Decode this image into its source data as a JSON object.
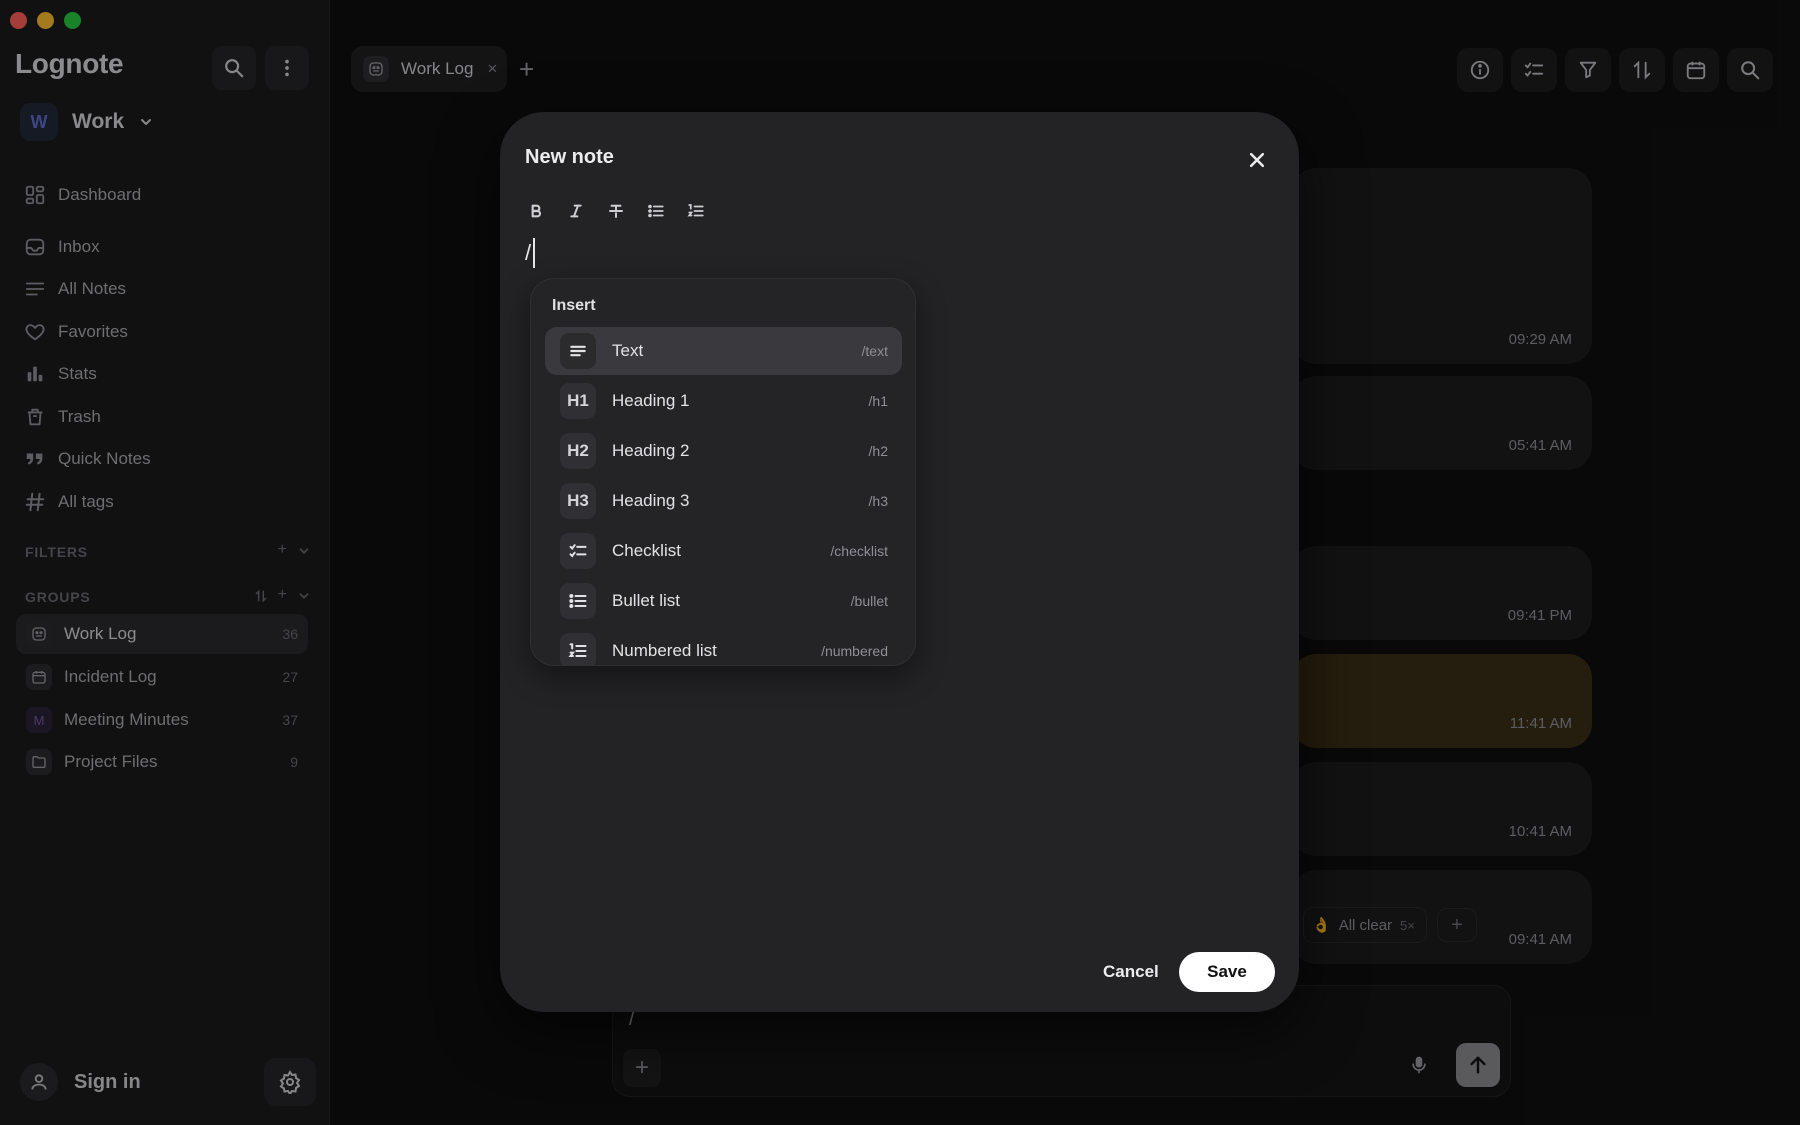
{
  "window": {
    "controls": [
      "close",
      "minimize",
      "zoom"
    ]
  },
  "sidebar": {
    "app_title": "Lognote",
    "workspace": {
      "avatar_letter": "W",
      "name": "Work"
    },
    "nav": [
      {
        "label": "Dashboard",
        "icon": "dashboard-icon"
      },
      {
        "label": "Inbox",
        "icon": "inbox-icon"
      },
      {
        "label": "All Notes",
        "icon": "notes-icon"
      },
      {
        "label": "Favorites",
        "icon": "heart-icon"
      },
      {
        "label": "Stats",
        "icon": "stats-icon"
      },
      {
        "label": "Trash",
        "icon": "trash-icon"
      },
      {
        "label": "Quick Notes",
        "icon": "quote-icon"
      },
      {
        "label": "All tags",
        "icon": "hash-icon"
      }
    ],
    "filters_label": "FILTERS",
    "groups_label": "GROUPS",
    "groups": [
      {
        "label": "Work Log",
        "count": "36",
        "icon": "worklog-icon"
      },
      {
        "label": "Incident Log",
        "count": "27",
        "icon": "calendar-icon"
      },
      {
        "label": "Meeting Minutes",
        "count": "37",
        "icon_letter": "M"
      },
      {
        "label": "Project Files",
        "count": "9",
        "icon": "folder-icon"
      }
    ],
    "signin_label": "Sign in"
  },
  "main": {
    "tab": {
      "label": "Work Log",
      "close": "×"
    },
    "new_tab": "+",
    "notes": [
      {
        "time": "09:29 AM"
      },
      {
        "time": "05:41 AM"
      },
      {
        "time": "09:41 PM"
      },
      {
        "time": "11:41 AM",
        "color": "#3a2d14"
      },
      {
        "time": "10:41 AM"
      },
      {
        "time": "09:41 AM"
      }
    ],
    "reaction": {
      "emoji": "👌",
      "label": "All clear",
      "count": "5×"
    },
    "reaction_add": "+",
    "composer": {
      "text": "/",
      "add": "+"
    }
  },
  "modal": {
    "title": "New note",
    "editor_text": "/",
    "format_buttons": [
      "bold",
      "italic",
      "strikethrough",
      "bullet-list",
      "numbered-list"
    ],
    "insert_menu": {
      "title": "Insert",
      "items": [
        {
          "label": "Text",
          "shortcut": "/text",
          "icon": "text-icon"
        },
        {
          "label": "Heading 1",
          "shortcut": "/h1",
          "icon_text": "H1"
        },
        {
          "label": "Heading 2",
          "shortcut": "/h2",
          "icon_text": "H2"
        },
        {
          "label": "Heading 3",
          "shortcut": "/h3",
          "icon_text": "H3"
        },
        {
          "label": "Checklist",
          "shortcut": "/checklist",
          "icon": "checklist-icon"
        },
        {
          "label": "Bullet list",
          "shortcut": "/bullet",
          "icon": "bullet-list-icon"
        },
        {
          "label": "Numbered list",
          "shortcut": "/numbered",
          "icon": "numbered-list-icon"
        }
      ]
    },
    "cancel_label": "Cancel",
    "save_label": "Save"
  },
  "colors": {
    "accent_workspace": "#5c6cc9",
    "save_button": "#ffffff",
    "highlight_note": "#3a2d14"
  }
}
